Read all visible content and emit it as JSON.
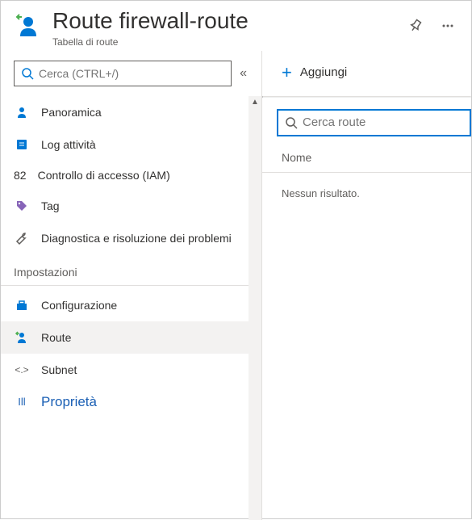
{
  "header": {
    "title": "Route firewall-route",
    "subtitle": "Tabella di route"
  },
  "sidebar": {
    "search_placeholder": "Cerca (CTRL+/)",
    "items": [
      {
        "label": "Panoramica"
      },
      {
        "label": "Log attività"
      },
      {
        "label": "Controllo di accesso (IAM)",
        "prefix": "82"
      },
      {
        "label": "Tag"
      },
      {
        "label": "Diagnostica e risoluzione dei problemi"
      }
    ],
    "section_label": "Impostazioni",
    "settings_items": [
      {
        "label": "Configurazione"
      },
      {
        "label": "Route"
      },
      {
        "label": "Subnet",
        "prefix": "<.>"
      },
      {
        "label": "Proprietà",
        "prefix": "Ill"
      }
    ]
  },
  "main": {
    "add_label": "Aggiungi",
    "route_search_placeholder": "Cerca route",
    "column_name": "Nome",
    "no_results": "Nessun risultato."
  }
}
